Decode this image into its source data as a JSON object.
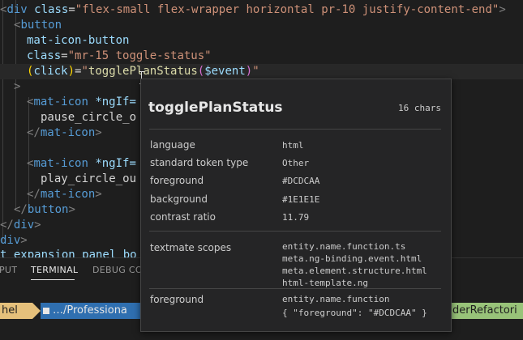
{
  "editor": {
    "l1": {
      "open": "<",
      "tag": "div",
      "attr": "class",
      "eq": "=",
      "str": "\"flex-small flex-wrapper horizontal pr-10 justify-content-end\"",
      "close": ">"
    },
    "l2": {
      "open": "<",
      "tag": "button"
    },
    "l3": {
      "attr": "mat-icon-button"
    },
    "l4": {
      "attr": "class",
      "eq": "=",
      "str": "\"mr-15 toggle-status\""
    },
    "l5": {
      "p1": "(",
      "attr": "click",
      "p2": ")",
      "eq": "=",
      "q1": "\"",
      "fn": "togglePlanStatus",
      "pa": "(",
      "var": "$event",
      "pb": ")",
      "q2": "\""
    },
    "l6": {
      "close": ">"
    },
    "l7": {
      "open": "<",
      "tag": "mat-icon",
      "attr": "*ngIf="
    },
    "l8": {
      "text": "pause_circle_o"
    },
    "l9": {
      "open": "</",
      "tag": "mat-icon",
      "close": ">"
    },
    "l11": {
      "open": "<",
      "tag": "mat-icon",
      "attr": "*ngIf="
    },
    "l12": {
      "text": "play_circle_ou"
    },
    "l13": {
      "open": "</",
      "tag": "mat-icon",
      "close": ">"
    },
    "l14": {
      "open": "</",
      "tag": "button",
      "close": ">"
    },
    "l15": {
      "open": "</",
      "tag": "div",
      "close": ">"
    },
    "l16": {
      "tag": "div",
      "close": ">"
    },
    "l17": {
      "text": "t expansion panel bo"
    }
  },
  "panel": {
    "tabs": [
      "PUT",
      "TERMINAL",
      "DEBUG CON"
    ],
    "active_tab": "TERMINAL"
  },
  "terminal": {
    "seg1": "hel",
    "seg2": "…/Professiona",
    "seg3": "derRefactori"
  },
  "hover": {
    "title": "togglePlanStatus",
    "chars": "16 chars",
    "rows": [
      {
        "label": "language",
        "value": "html"
      },
      {
        "label": "standard token type",
        "value": "Other"
      },
      {
        "label": "foreground",
        "value": "#DCDCAA"
      },
      {
        "label": "background",
        "value": "#1E1E1E"
      },
      {
        "label": "contrast ratio",
        "value": "11.79"
      }
    ],
    "scopes_label": "textmate scopes",
    "scopes": [
      "entity.name.function.ts",
      "meta.ng-binding.event.html",
      "meta.element.structure.html",
      "html-template.ng"
    ],
    "fg_label": "foreground",
    "fg_scope": "entity.name.function",
    "fg_rule": "{ \"foreground\": \"#DCDCAA\" }"
  },
  "colors": {
    "tag": "#569cd6",
    "attr": "#9cdcfe",
    "string": "#ce9178",
    "function": "#dcdcaa",
    "seg1_bg": "#e5c07b",
    "seg2_bg": "#3a8fd6",
    "seg3_bg": "#98c379"
  }
}
